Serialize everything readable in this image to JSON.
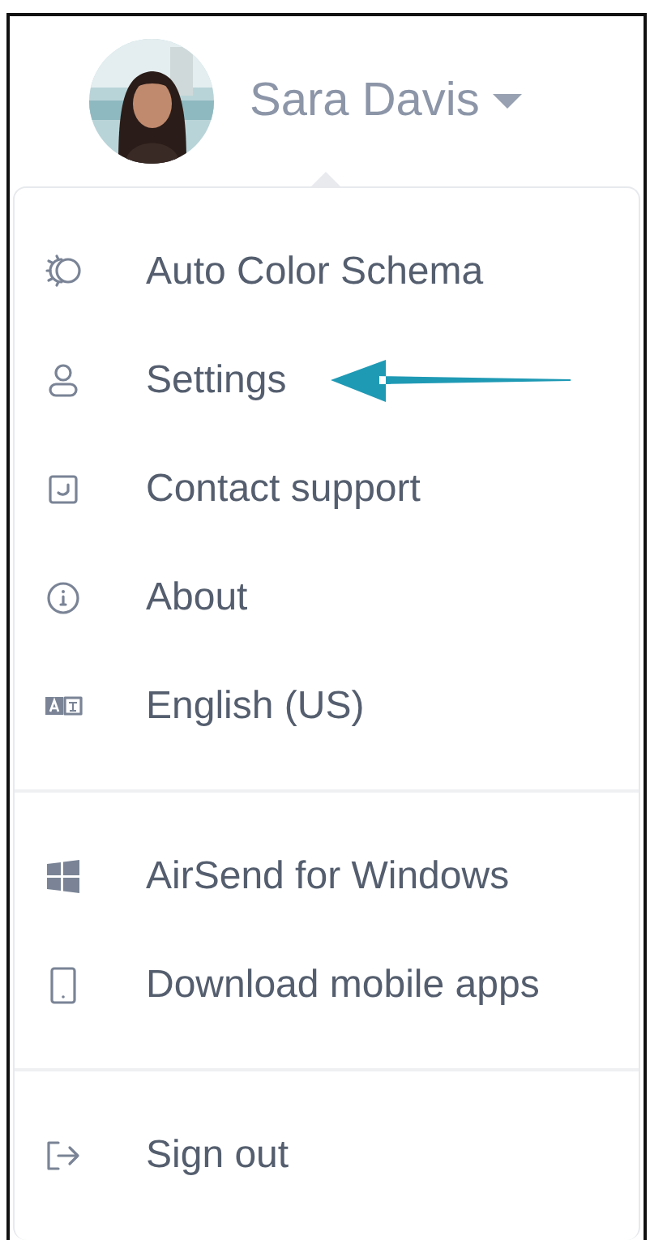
{
  "user": {
    "name": "Sara Davis"
  },
  "sections": [
    {
      "items": [
        {
          "label": "Auto Color Schema",
          "pointed": false
        },
        {
          "label": "Settings",
          "pointed": true
        },
        {
          "label": "Contact support",
          "pointed": false
        },
        {
          "label": "About",
          "pointed": false
        },
        {
          "label": "English (US)",
          "pointed": false
        }
      ]
    },
    {
      "items": [
        {
          "label": "AirSend for Windows",
          "pointed": false
        },
        {
          "label": "Download mobile apps",
          "pointed": false
        }
      ]
    },
    {
      "items": [
        {
          "label": "Sign out",
          "pointed": false
        }
      ]
    }
  ]
}
